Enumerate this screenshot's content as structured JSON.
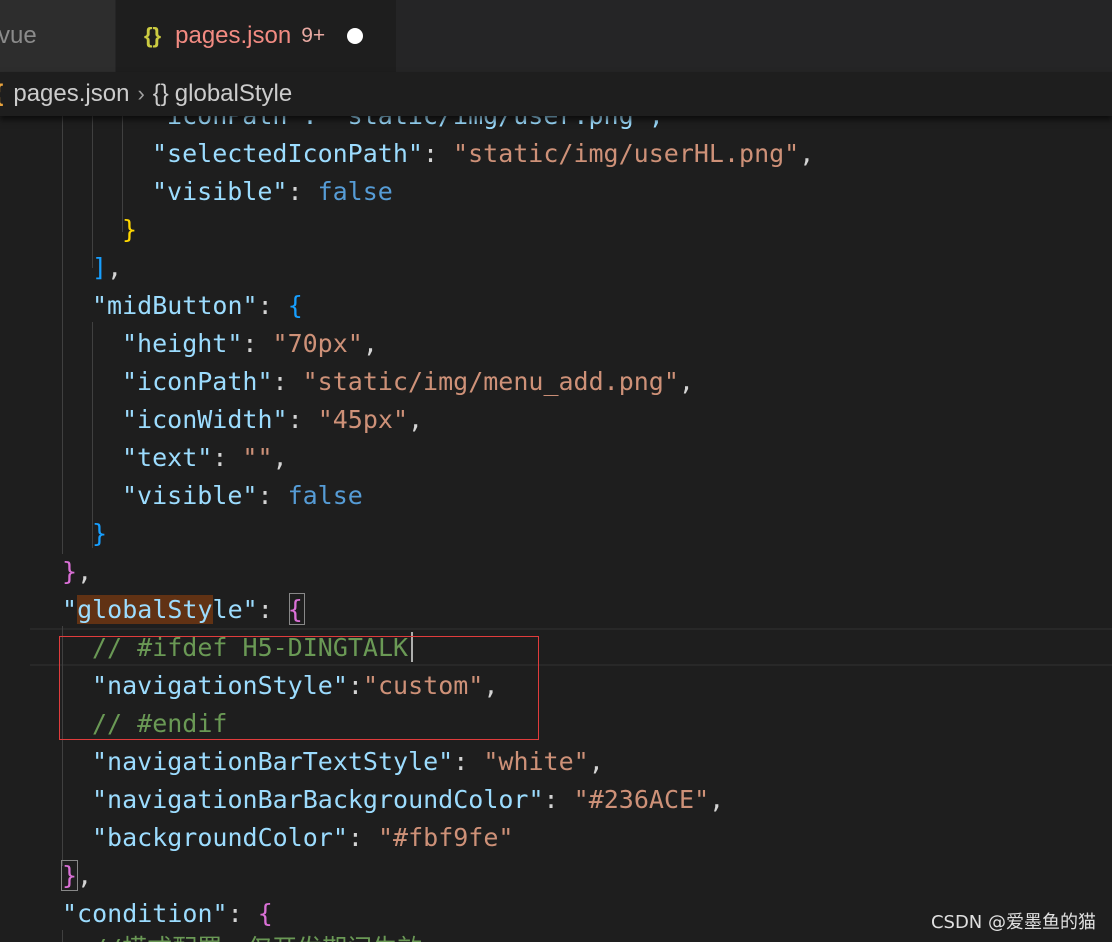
{
  "tabs": [
    {
      "label": "vue",
      "active": false
    },
    {
      "label": "pages.json",
      "icon": "{}",
      "problems": "9+",
      "unsaved": true,
      "active": true
    }
  ],
  "breadcrumb": {
    "file": "pages.json",
    "symbol": "globalStyle",
    "symbol_icon": "{}"
  },
  "code_lines": [
    [
      "\"iconPath\": \"static/img/user.png\","
    ],
    [
      "\"selectedIconPath\"",
      ": ",
      "\"static/img/userHL.png\"",
      ","
    ],
    [
      "\"visible\"",
      ": ",
      "false"
    ],
    [
      "}"
    ],
    [
      "],"
    ],
    [
      "\"midButton\"",
      ": ",
      "{"
    ],
    [
      "\"height\"",
      ": ",
      "\"70px\"",
      ","
    ],
    [
      "\"iconPath\"",
      ": ",
      "\"static/img/menu_add.png\"",
      ","
    ],
    [
      "\"iconWidth\"",
      ": ",
      "\"45px\"",
      ","
    ],
    [
      "\"text\"",
      ": ",
      "\"\"",
      ","
    ],
    [
      "\"visible\"",
      ": ",
      "false"
    ],
    [
      "}"
    ],
    [
      "},"
    ],
    [
      "\"globalStyle\"",
      ": ",
      "{"
    ],
    [
      "// #ifdef H5-DINGTALK"
    ],
    [
      "\"navigationStyle\"",
      ":",
      "\"custom\"",
      ","
    ],
    [
      "// #endif"
    ],
    [
      "\"navigationBarTextStyle\"",
      ": ",
      "\"white\"",
      ","
    ],
    [
      "\"navigationBarBackgroundColor\"",
      ": ",
      "\"#236ACE\"",
      ","
    ],
    [
      "\"backgroundColor\"",
      ": ",
      "\"#fbf9fe\""
    ],
    [
      "},"
    ],
    [
      "\"condition\"",
      ": ",
      "{"
    ],
    [
      "//模式配置，仅开发期间生效"
    ]
  ],
  "watermark": "CSDN @爱墨鱼的猫",
  "colors": {
    "background": "#1e1e1e",
    "key": "#9cdcfe",
    "string": "#ce9178",
    "keyword": "#569cd6",
    "comment": "#6a9955",
    "highlight_box": "#e03c3c"
  }
}
